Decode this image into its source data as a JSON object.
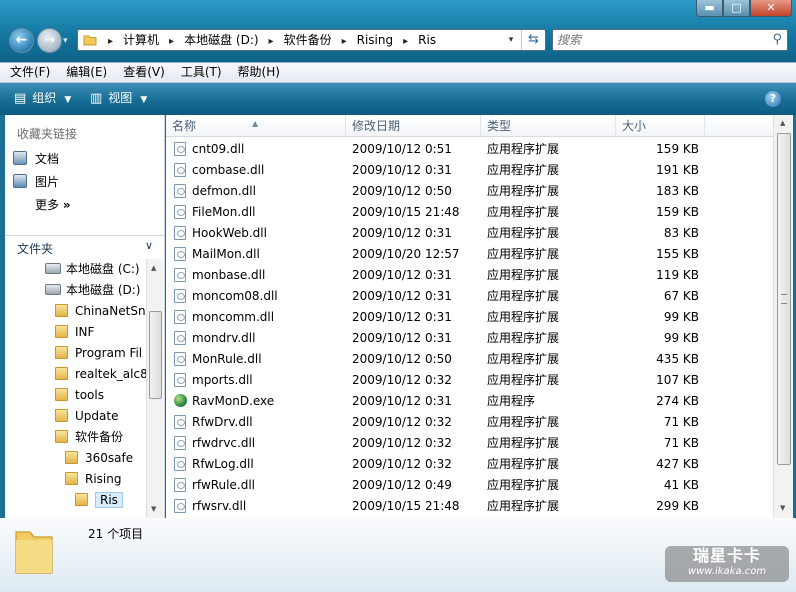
{
  "window": {
    "min_glyph": "▬",
    "max_glyph": "□",
    "close_glyph": "✕"
  },
  "nav": {
    "back_glyph": "←",
    "forward_glyph": "→",
    "history_glyph": "▾"
  },
  "address": {
    "crumbs": [
      "计算机",
      "本地磁盘 (D:)",
      "软件备份",
      "Rising",
      "Ris"
    ],
    "separator": "▸"
  },
  "search": {
    "placeholder": "搜索"
  },
  "menu": [
    "文件(F)",
    "编辑(E)",
    "查看(V)",
    "工具(T)",
    "帮助(H)"
  ],
  "toolbar": {
    "organize": "组织",
    "views": "视图",
    "help": "?"
  },
  "sidebar": {
    "favorites_title": "收藏夹链接",
    "favorites": [
      "文档",
      "图片",
      "更多"
    ],
    "more_glyph": "»",
    "folders_title": "文件夹",
    "folders_glyph": "∨",
    "tree": [
      {
        "label": "本地磁盘 (C:)",
        "kind": "drive",
        "level": 0
      },
      {
        "label": "本地磁盘 (D:)",
        "kind": "drive",
        "level": 0
      },
      {
        "label": "ChinaNetSn",
        "kind": "folder",
        "level": 1
      },
      {
        "label": "INF",
        "kind": "folder",
        "level": 1
      },
      {
        "label": "Program Fil",
        "kind": "folder",
        "level": 1
      },
      {
        "label": "realtek_alc8",
        "kind": "folder",
        "level": 1
      },
      {
        "label": "tools",
        "kind": "folder",
        "level": 1
      },
      {
        "label": "Update",
        "kind": "folder",
        "level": 1
      },
      {
        "label": "软件备份",
        "kind": "folder",
        "level": 1
      },
      {
        "label": "360safe",
        "kind": "folder",
        "level": 2
      },
      {
        "label": "Rising",
        "kind": "folder",
        "level": 2
      },
      {
        "label": "Ris",
        "kind": "folder",
        "level": 3,
        "selected": true
      }
    ]
  },
  "list": {
    "columns": [
      "名称",
      "修改日期",
      "类型",
      "大小"
    ],
    "sort_glyph": "▲",
    "rows": [
      [
        "cnt09.dll",
        "2009/10/12 0:51",
        "应用程序扩展",
        "159 KB"
      ],
      [
        "combase.dll",
        "2009/10/12 0:31",
        "应用程序扩展",
        "191 KB"
      ],
      [
        "defmon.dll",
        "2009/10/12 0:50",
        "应用程序扩展",
        "183 KB"
      ],
      [
        "FileMon.dll",
        "2009/10/15 21:48",
        "应用程序扩展",
        "159 KB"
      ],
      [
        "HookWeb.dll",
        "2009/10/12 0:31",
        "应用程序扩展",
        "83 KB"
      ],
      [
        "MailMon.dll",
        "2009/10/20 12:57",
        "应用程序扩展",
        "155 KB"
      ],
      [
        "monbase.dll",
        "2009/10/12 0:31",
        "应用程序扩展",
        "119 KB"
      ],
      [
        "moncom08.dll",
        "2009/10/12 0:31",
        "应用程序扩展",
        "67 KB"
      ],
      [
        "moncomm.dll",
        "2009/10/12 0:31",
        "应用程序扩展",
        "99 KB"
      ],
      [
        "mondrv.dll",
        "2009/10/12 0:31",
        "应用程序扩展",
        "99 KB"
      ],
      [
        "MonRule.dll",
        "2009/10/12 0:50",
        "应用程序扩展",
        "435 KB"
      ],
      [
        "mports.dll",
        "2009/10/12 0:32",
        "应用程序扩展",
        "107 KB"
      ],
      [
        "RavMonD.exe",
        "2009/10/12 0:31",
        "应用程序",
        "274 KB"
      ],
      [
        "RfwDrv.dll",
        "2009/10/12 0:32",
        "应用程序扩展",
        "71 KB"
      ],
      [
        "rfwdrvc.dll",
        "2009/10/12 0:32",
        "应用程序扩展",
        "71 KB"
      ],
      [
        "RfwLog.dll",
        "2009/10/12 0:32",
        "应用程序扩展",
        "427 KB"
      ],
      [
        "rfwRule.dll",
        "2009/10/12 0:49",
        "应用程序扩展",
        "41 KB"
      ],
      [
        "rfwsrv.dll",
        "2009/10/15 21:48",
        "应用程序扩展",
        "299 KB"
      ]
    ]
  },
  "details": {
    "count": "21 个项目"
  },
  "watermark": {
    "line1": "瑞星卡卡",
    "line2": "www.ikaka.com"
  }
}
